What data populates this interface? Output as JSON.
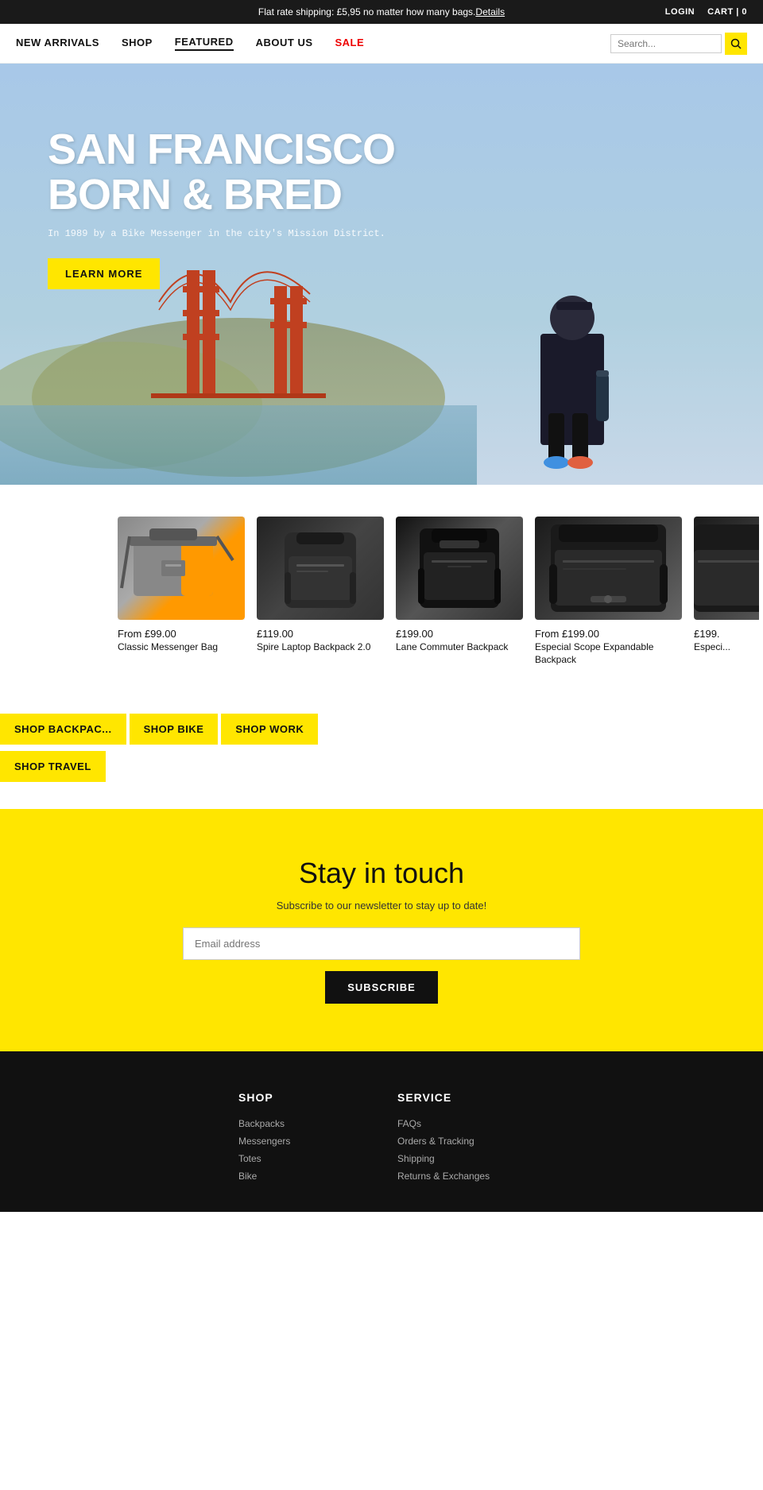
{
  "topBanner": {
    "text": "Flat rate shipping: £5,95 no matter how many bags.",
    "link_text": "Details",
    "login": "LOGIN",
    "cart": "CART | 0"
  },
  "nav": {
    "links": [
      {
        "label": "NEW ARRIVALS",
        "class": ""
      },
      {
        "label": "SHOP",
        "class": ""
      },
      {
        "label": "FEATURED",
        "class": "featured"
      },
      {
        "label": "ABOUT US",
        "class": ""
      },
      {
        "label": "SALE",
        "class": "sale"
      }
    ],
    "search_placeholder": "Search..."
  },
  "hero": {
    "title_line1": "SAN FRANCISCO",
    "title_line2": "BORN & BRED",
    "subtitle": "In 1989 by a Bike Messenger in the city's Mission District.",
    "cta_label": "LEARN MORE"
  },
  "products": [
    {
      "price": "From  £99.00",
      "name": "Classic Messenger Bag",
      "bag_type": "messenger"
    },
    {
      "price": "£119.00",
      "name": "Spire Laptop Backpack 2.0",
      "bag_type": "backpack-dark"
    },
    {
      "price": "£199.00",
      "name": "Lane Commuter Backpack",
      "bag_type": "backpack-black"
    },
    {
      "price": "From  £199.00",
      "name": "Especial Scope Expandable Backpack",
      "bag_type": "expandable"
    },
    {
      "price": "£199.",
      "name": "Especi...",
      "bag_type": "partial"
    }
  ],
  "shopButtons": [
    {
      "label": "SHOP BACKPAC...",
      "row": 1
    },
    {
      "label": "SHOP BIKE",
      "row": 1
    },
    {
      "label": "SHOP WORK",
      "row": 1
    },
    {
      "label": "SHOP TRAVEL",
      "row": 2
    }
  ],
  "newsletter": {
    "title": "Stay in touch",
    "subtitle": "Subscribe to our newsletter to stay up to date!",
    "input_placeholder": "Email address",
    "button_label": "SUBSCRIBE"
  },
  "footer": {
    "columns": [
      {
        "title": "SHOP",
        "links": [
          "Backpacks",
          "Messengers",
          "Totes",
          "Bike"
        ]
      },
      {
        "title": "SERVICE",
        "links": [
          "FAQs",
          "Orders & Tracking",
          "Shipping",
          "Returns & Exchanges"
        ]
      }
    ]
  }
}
